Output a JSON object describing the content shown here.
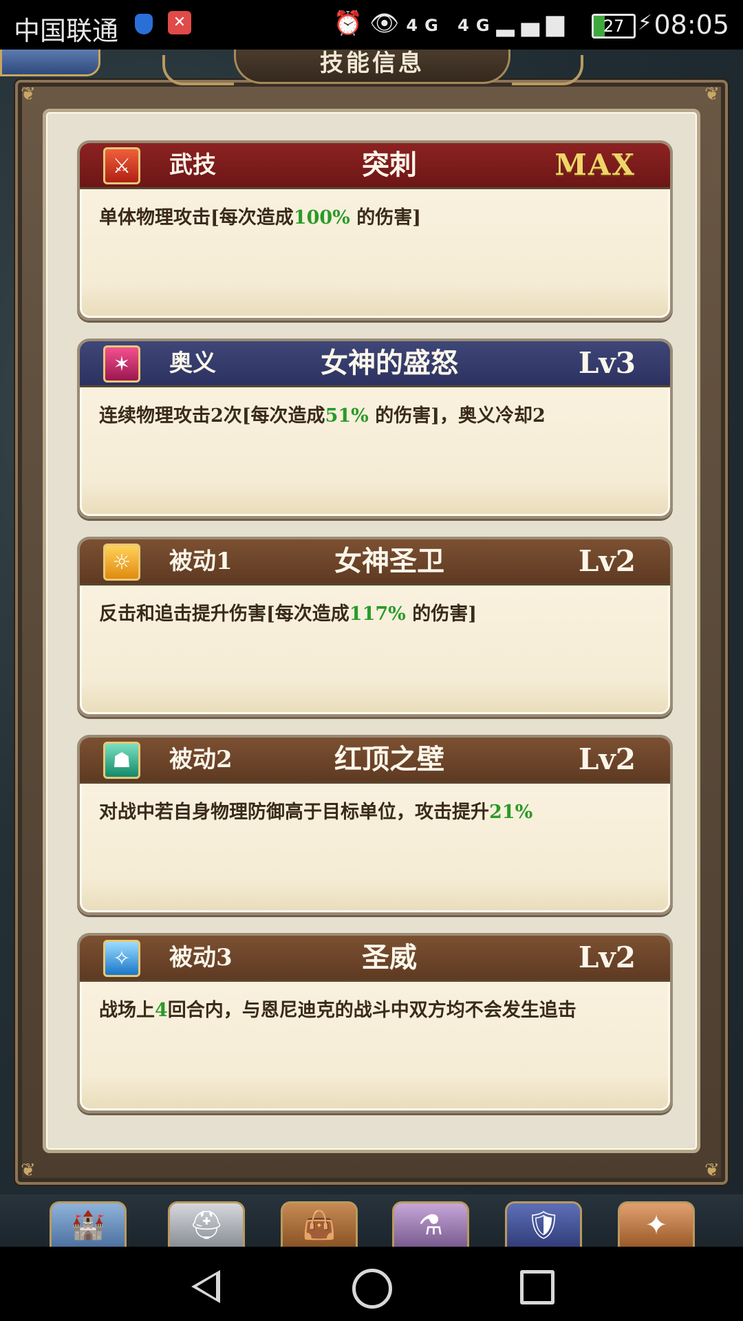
{
  "status_bar": {
    "carrier": "中国联通",
    "network": "4G 4G",
    "battery": "27",
    "battery_level": 0.27,
    "time": "08:05",
    "icons": [
      "vpn-shield-icon",
      "app-notification-icon",
      "alarm-icon",
      "eye-comfort-icon",
      "signal-icon",
      "battery-icon",
      "charging-icon"
    ]
  },
  "dialog": {
    "title": "技能信息"
  },
  "skills": [
    {
      "type": "武技",
      "name": "突刺",
      "level": "MAX",
      "header_color": "#7a1c1c",
      "icon": "sword-icon",
      "desc_before": "单体物理攻击[每次造成",
      "desc_highlight": "100%",
      "desc_after": " 的伤害]"
    },
    {
      "type": "奥义",
      "name": "女神的盛怒",
      "level": "Lv3",
      "header_color": "#333a6a",
      "icon": "flame-slash-icon",
      "desc_before": "连续物理攻击2次[每次造成",
      "desc_highlight": "51%",
      "desc_after": " 的伤害]，奥义冷却2"
    },
    {
      "type": "被动1",
      "name": "女神圣卫",
      "level": "Lv2",
      "header_color": "#6b4329",
      "icon": "aura-guard-icon",
      "desc_before": "反击和追击提升伤害[每次造成",
      "desc_highlight": "117%",
      "desc_after": " 的伤害]"
    },
    {
      "type": "被动2",
      "name": "红顶之壁",
      "level": "Lv2",
      "header_color": "#6b4329",
      "icon": "barrier-icon",
      "desc_before": "对战中若自身物理防御高于目标单位，攻击提升",
      "desc_highlight": "21%",
      "desc_after": ""
    },
    {
      "type": "被动3",
      "name": "圣威",
      "level": "Lv2",
      "header_color": "#6b4329",
      "icon": "holy-figure-icon",
      "desc_before": "战场上",
      "desc_highlight": "4",
      "desc_after": "回合内，与恩尼迪克的战斗中双方均不会发生追击"
    }
  ],
  "colors": {
    "highlight": "#2a9a2a",
    "max_gold": "#f0d56a",
    "card_bg": "#f7efd9"
  },
  "bottom_menu": [
    "castle-icon",
    "helmet-icon",
    "item-bag-icon",
    "potion-icon",
    "guild-shield-icon",
    "summon-icon"
  ],
  "nav_bar": [
    "back-icon",
    "home-icon",
    "recent-apps-icon"
  ]
}
